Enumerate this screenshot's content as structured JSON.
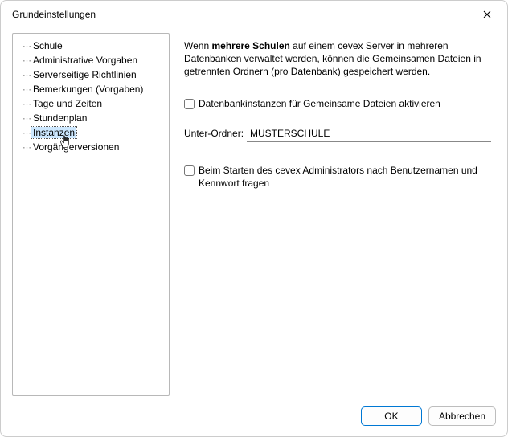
{
  "window": {
    "title": "Grundeinstellungen",
    "close_tooltip": "Schließen"
  },
  "tree": {
    "items": [
      {
        "label": "Schule",
        "selected": false
      },
      {
        "label": "Administrative Vorgaben",
        "selected": false
      },
      {
        "label": "Serverseitige Richtlinien",
        "selected": false
      },
      {
        "label": "Bemerkungen (Vorgaben)",
        "selected": false
      },
      {
        "label": "Tage und Zeiten",
        "selected": false
      },
      {
        "label": "Stundenplan",
        "selected": false
      },
      {
        "label": "Instanzen",
        "selected": true
      },
      {
        "label": "Vorgängerversionen",
        "selected": false
      }
    ]
  },
  "content": {
    "description_pre": "Wenn ",
    "description_bold": "mehrere Schulen",
    "description_post": " auf einem cevex Server in mehreren Datenbanken verwaltet werden, können die Gemeinsamen Dateien in getrennten Ordnern (pro Datenbank) gespeichert werden.",
    "checkbox1_label": "Datenbankinstanzen für Gemeinsame Dateien aktivieren",
    "checkbox1_checked": false,
    "subfolder_label": "Unter-Ordner:",
    "subfolder_value": "MUSTERSCHULE",
    "checkbox2_label": "Beim Starten des cevex Administrators nach Benutzernamen und Kennwort fragen",
    "checkbox2_checked": false
  },
  "footer": {
    "ok": "OK",
    "cancel": "Abbrechen"
  }
}
